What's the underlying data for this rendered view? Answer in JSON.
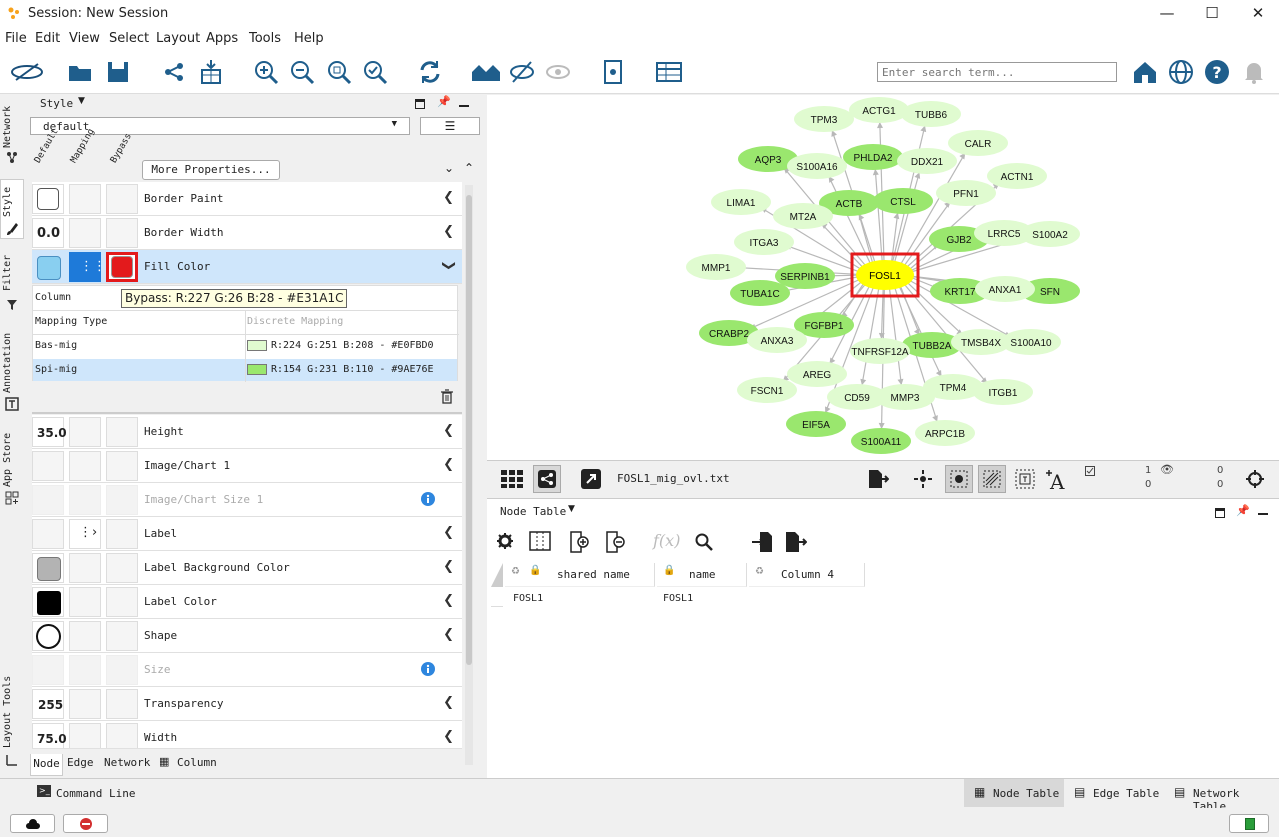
{
  "window": {
    "title": "Session: New Session"
  },
  "menu": [
    "File",
    "Edit",
    "View",
    "Select",
    "Layout",
    "Apps",
    "Tools",
    "Help"
  ],
  "search": {
    "placeholder": "Enter search term..."
  },
  "vtabs": [
    "Network",
    "Style",
    "Filter",
    "Annotation",
    "App Store",
    "Layout Tools"
  ],
  "style": {
    "header": "Style",
    "selected_style": "default",
    "col_headers": [
      "Default",
      "Mapping",
      "Bypass"
    ],
    "more_props": "More Properties...",
    "rows": {
      "border_paint": "Border Paint",
      "border_width": "Border Width",
      "border_width_val": "0.0",
      "fill_color": "Fill Color",
      "height": "Height",
      "height_val": "35.0",
      "image_chart": "Image/Chart 1",
      "image_chart_size": "Image/Chart Size 1",
      "label": "Label",
      "label_bg": "Label Background Color",
      "label_color": "Label Color",
      "shape": "Shape",
      "size": "Size",
      "transparency": "Transparency",
      "transparency_val": "255",
      "width": "Width",
      "width_val": "75.0"
    },
    "mapping": {
      "column_label": "Column",
      "mapping_type_label": "Mapping Type",
      "mapping_type_value": "Discrete Mapping",
      "entries": [
        {
          "key": "Bas-mig",
          "value": "R:224 G:251 B:208 - #E0FBD0",
          "color": "#E0FBD0"
        },
        {
          "key": "Spi-mig",
          "value": "R:154 G:231 B:110 - #9AE76E",
          "color": "#9AE76E"
        }
      ]
    },
    "tooltip": "Bypass: R:227 G:26 B:28 - #E31A1C",
    "bypass_color": "#E31A1C",
    "bottom_tabs": [
      "Node",
      "Edge",
      "Network",
      "Column"
    ]
  },
  "network": {
    "filename": "FOSL1_mig_ovl.txt",
    "sel_nodes": "1",
    "sel_nodes_total": "0",
    "hidden_nodes": "0",
    "hidden_total": "0",
    "center": "FOSL1",
    "nodes_dark": [
      "AQP3",
      "PHLDA2",
      "ACTB",
      "CTSL",
      "GJB2",
      "SERPINB1",
      "TUBA1C",
      "KRT17",
      "SFN",
      "FGFBP1",
      "CRABP2",
      "TUBB2A",
      "EIF5A",
      "S100A11"
    ],
    "nodes_light": [
      "TPM3",
      "ACTG1",
      "TUBB6",
      "CALR",
      "S100A16",
      "DDX21",
      "ACTN1",
      "PFN1",
      "LIMA1",
      "MT2A",
      "ITGA3",
      "LRRC5",
      "S100A2",
      "MMP1",
      "ANXA1",
      "ANXA3",
      "TNFRSF12A",
      "TMSB4X",
      "S100A10",
      "AREG",
      "FSCN1",
      "CD59",
      "MMP3",
      "TPM4",
      "ITGB1",
      "ARPC1B"
    ]
  },
  "table": {
    "title": "Node Table",
    "columns": [
      "shared name",
      "name",
      "Column 4"
    ],
    "rows": [
      {
        "shared_name": "FOSL1",
        "name": "FOSL1"
      }
    ]
  },
  "bottom_tabs": [
    "Node Table",
    "Edge Table",
    "Network Table"
  ],
  "command_line": "Command Line"
}
